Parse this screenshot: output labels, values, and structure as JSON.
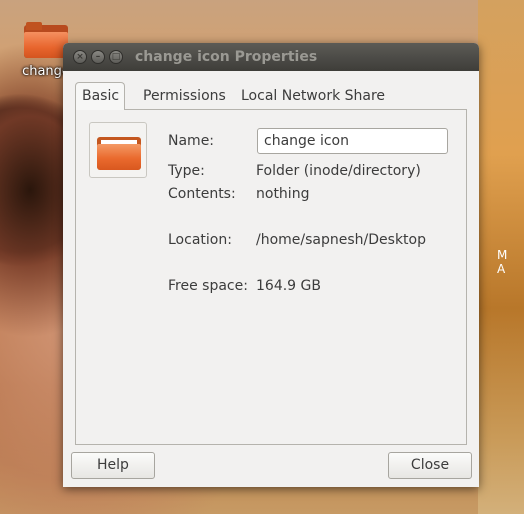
{
  "desktop": {
    "icon_label": "change",
    "side_text": "M A"
  },
  "window": {
    "title": "change icon Properties",
    "tabs": [
      {
        "label": "Basic",
        "active": true
      },
      {
        "label": "Permissions",
        "active": false
      },
      {
        "label": "Local Network Share",
        "active": false
      }
    ],
    "basic": {
      "name_label": "Name:",
      "name_value": "change icon",
      "type_label": "Type:",
      "type_value": "Folder (inode/directory)",
      "contents_label": "Contents:",
      "contents_value": "nothing",
      "location_label": "Location:",
      "location_value": "/home/sapnesh/Desktop",
      "free_space_label": "Free space:",
      "free_space_value": "164.9 GB"
    },
    "buttons": {
      "help": "Help",
      "close": "Close"
    }
  },
  "colors": {
    "titlebar": "#3e3d39",
    "title_text": "#9a9993",
    "folder_accent": "#e8652d"
  }
}
